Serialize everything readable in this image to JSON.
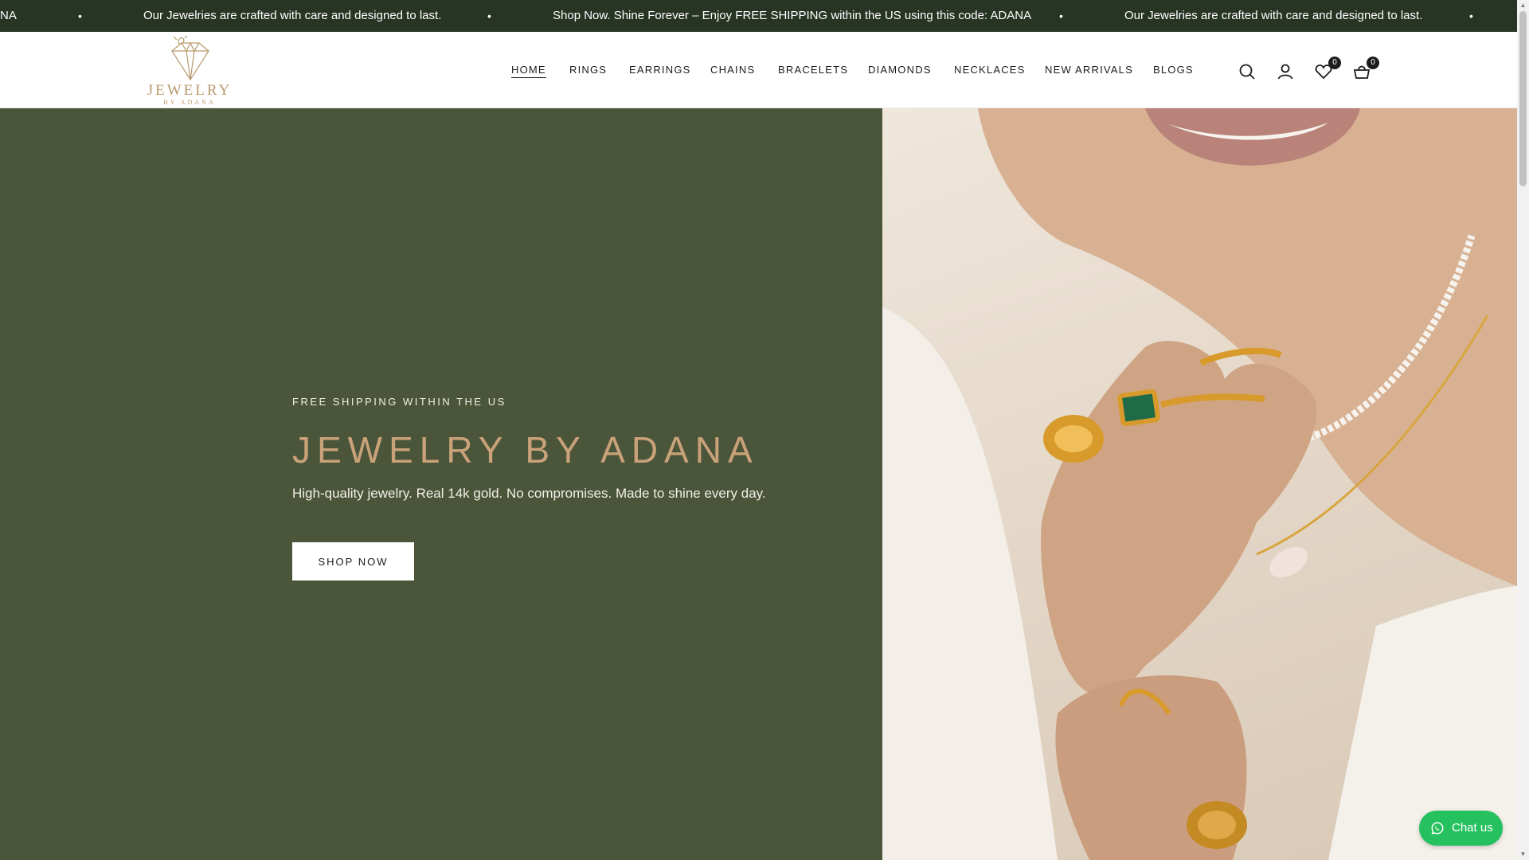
{
  "announcement": {
    "items": [
      "NA",
      "Our Jewelries are crafted with care and designed to last.",
      "Shop Now. Shine Forever – Enjoy FREE SHIPPING within the US using this code: ADANA",
      "Our Jewelries are crafted with care and designed to last."
    ],
    "separator": "•"
  },
  "logo": {
    "wordmark": "JEWELRY",
    "subword": "BY ADANA",
    "color": "#b99a6e"
  },
  "nav": {
    "items": [
      {
        "label": "HOME",
        "active": true
      },
      {
        "label": "RINGS",
        "active": false
      },
      {
        "label": "EARRINGS",
        "active": false
      },
      {
        "label": "CHAINS",
        "active": false
      },
      {
        "label": "BRACELETS",
        "active": false
      },
      {
        "label": "DIAMONDS",
        "active": false
      },
      {
        "label": "NECKLACES",
        "active": false
      },
      {
        "label": "NEW ARRIVALS",
        "active": false
      },
      {
        "label": "BLOGS",
        "active": false
      }
    ]
  },
  "header_icons": {
    "search": "search-icon",
    "account": "user-icon",
    "wishlist": "heart-icon",
    "wishlist_count": "0",
    "cart": "shopping-basket-icon",
    "cart_count": "0"
  },
  "hero": {
    "eyebrow": "FREE SHIPPING WITHIN THE US",
    "title": "JEWELRY BY ADANA",
    "subtitle": "High-quality jewelry. Real 14k gold. No compromises. Made to shine every day.",
    "button_label": "SHOP NOW",
    "background_color": "#4a553a",
    "title_color": "#c9a27a"
  },
  "chat": {
    "label": "Chat us",
    "icon": "whatsapp-icon",
    "color": "#25c15f"
  },
  "colors": {
    "announcement_bg": "#283525",
    "text": "#1c1c1c"
  }
}
